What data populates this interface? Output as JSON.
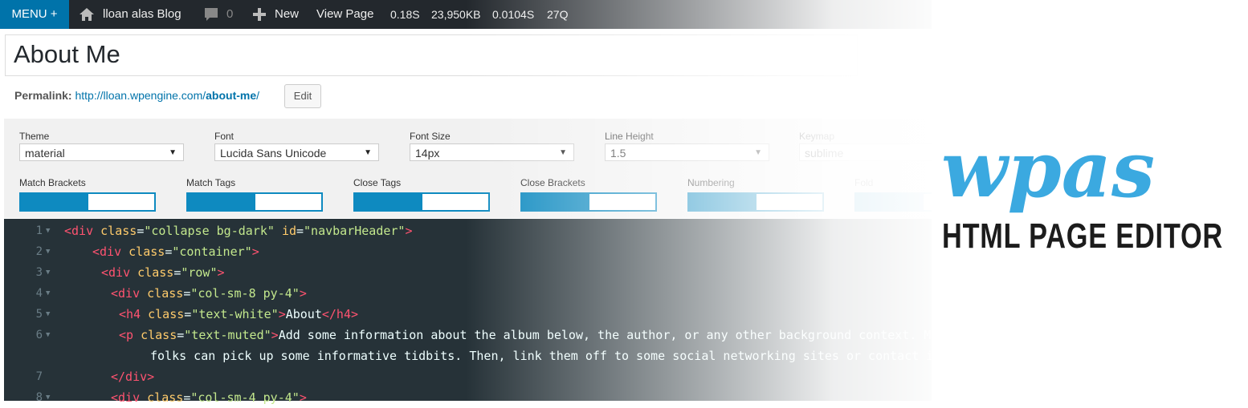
{
  "admin_bar": {
    "menu_label": "MENU +",
    "site_name": "lloan alas Blog",
    "comments_count": "0",
    "new_label": "New",
    "view_page_label": "View Page",
    "stats": [
      "0.18S",
      "23,950KB",
      "0.0104S",
      "27Q"
    ]
  },
  "post": {
    "title": "About Me",
    "permalink_label": "Permalink:",
    "permalink_base": "http://lloan.wpengine.com/",
    "permalink_slug": "about-me",
    "permalink_tail": "/",
    "edit_label": "Edit"
  },
  "settings": {
    "theme": {
      "label": "Theme",
      "value": "material"
    },
    "font": {
      "label": "Font",
      "value": "Lucida Sans Unicode"
    },
    "font_size": {
      "label": "Font Size",
      "value": "14px"
    },
    "line_height": {
      "label": "Line Height",
      "value": "1.5"
    },
    "keymap": {
      "label": "Keymap",
      "value": "sublime"
    },
    "toggles": [
      {
        "label": "Match Brackets",
        "on": true
      },
      {
        "label": "Match Tags",
        "on": true
      },
      {
        "label": "Close Tags",
        "on": true
      },
      {
        "label": "Close Brackets",
        "on": true
      },
      {
        "label": "Numbering",
        "on": true
      },
      {
        "label": "Fold",
        "on": true
      }
    ]
  },
  "code_lines": [
    {
      "num": "1",
      "fold": true,
      "indent": 0,
      "tokens": [
        [
          "tag",
          "<div "
        ],
        [
          "attr",
          "class"
        ],
        [
          "txt",
          "="
        ],
        [
          "str",
          "\"collapse bg-dark\""
        ],
        [
          "txt",
          " "
        ],
        [
          "attr",
          "id"
        ],
        [
          "txt",
          "="
        ],
        [
          "str",
          "\"navbarHeader\""
        ],
        [
          "tag",
          ">"
        ]
      ]
    },
    {
      "num": "2",
      "fold": true,
      "indent": 1,
      "tokens": [
        [
          "tag",
          "<div "
        ],
        [
          "attr",
          "class"
        ],
        [
          "txt",
          "="
        ],
        [
          "str",
          "\"container\""
        ],
        [
          "tag",
          ">"
        ]
      ]
    },
    {
      "num": "3",
      "fold": true,
      "indent": 2,
      "tokens": [
        [
          "tag",
          "<div "
        ],
        [
          "attr",
          "class"
        ],
        [
          "txt",
          "="
        ],
        [
          "str",
          "\"row\""
        ],
        [
          "tag",
          ">"
        ]
      ]
    },
    {
      "num": "4",
      "fold": true,
      "indent": 3,
      "tokens": [
        [
          "tag",
          "<div "
        ],
        [
          "attr",
          "class"
        ],
        [
          "txt",
          "="
        ],
        [
          "str",
          "\"col-sm-8 py-4\""
        ],
        [
          "tag",
          ">"
        ]
      ]
    },
    {
      "num": "5",
      "fold": true,
      "indent": 4,
      "tokens": [
        [
          "tag",
          "<h4 "
        ],
        [
          "attr",
          "class"
        ],
        [
          "txt",
          "="
        ],
        [
          "str",
          "\"text-white\""
        ],
        [
          "tag",
          ">"
        ],
        [
          "txt",
          "About"
        ],
        [
          "tag",
          "</h4>"
        ]
      ]
    },
    {
      "num": "6",
      "fold": true,
      "indent": 4,
      "tokens": [
        [
          "tag",
          "<p "
        ],
        [
          "attr",
          "class"
        ],
        [
          "txt",
          "="
        ],
        [
          "str",
          "\"text-muted\""
        ],
        [
          "tag",
          ">"
        ],
        [
          "txt",
          "Add some information about the album below, the author, or any other background context. Make it a few sentences long so"
        ]
      ]
    },
    {
      "num": "",
      "fold": false,
      "indent": 5,
      "tokens": [
        [
          "txt",
          "folks can pick up some informative tidbits. Then, link them off to some social networking sites or contact information."
        ]
      ]
    },
    {
      "num": "7",
      "fold": false,
      "indent": 3,
      "tokens": [
        [
          "tag",
          "</div>"
        ]
      ]
    },
    {
      "num": "8",
      "fold": true,
      "indent": 3,
      "tokens": [
        [
          "tag",
          "<div "
        ],
        [
          "attr",
          "class"
        ],
        [
          "txt",
          "="
        ],
        [
          "str",
          "\"col-sm-4 py-4\""
        ],
        [
          "tag",
          ">"
        ]
      ]
    }
  ],
  "brand": {
    "logo_text": "wpas",
    "tagline": "HTML PAGE EDITOR",
    "logo_color": "#3ba9e0"
  },
  "colors": {
    "admin_bar_bg": "#23282d",
    "menu_accent": "#0073aa",
    "toggle_accent": "#0e8ac0",
    "editor_bg": "#263238"
  }
}
